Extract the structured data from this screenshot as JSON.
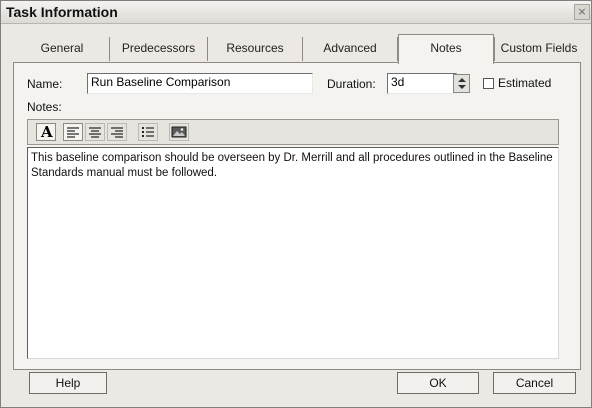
{
  "title": "Task Information",
  "close_glyph": "×",
  "tabs": [
    {
      "label": "General",
      "active": false
    },
    {
      "label": "Predecessors",
      "active": false
    },
    {
      "label": "Resources",
      "active": false
    },
    {
      "label": "Advanced",
      "active": false
    },
    {
      "label": "Notes",
      "active": true
    },
    {
      "label": "Custom Fields",
      "active": false
    }
  ],
  "form": {
    "name_label": "Name:",
    "name_value": "Run Baseline Comparison",
    "duration_label": "Duration:",
    "duration_value": "3d",
    "estimated_label": "Estimated",
    "estimated_checked": false,
    "notes_label": "Notes:"
  },
  "toolbar": {
    "font_glyph": "A",
    "icons": [
      "font-icon",
      "align-left-icon",
      "align-center-icon",
      "align-right-icon",
      "bulleted-list-icon",
      "insert-object-icon"
    ]
  },
  "notes_text": "This baseline comparison should be overseen by Dr. Merrill and all procedures outlined in the Baseline Standards manual must be followed.",
  "buttons": {
    "help": "Help",
    "ok": "OK",
    "cancel": "Cancel"
  }
}
